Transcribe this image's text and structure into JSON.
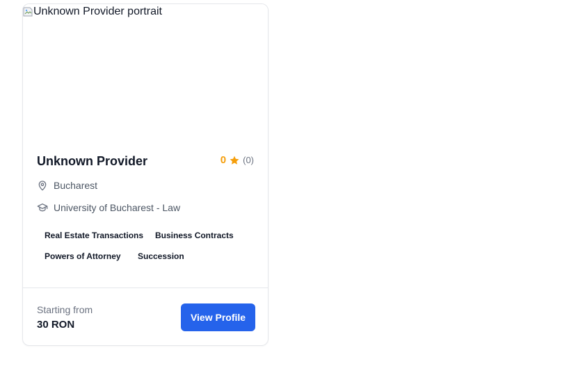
{
  "card": {
    "portrait_alt": "Unknown Provider portrait",
    "name": "Unknown Provider",
    "rating": {
      "value": "0",
      "count": "(0)",
      "star_icon": "star-icon",
      "star_color": "#f59e0b"
    },
    "location": {
      "icon": "map-pin-icon",
      "text": "Bucharest"
    },
    "education": {
      "icon": "graduation-cap-icon",
      "text": "University of Bucharest - Law"
    },
    "tags": [
      "Real Estate Transactions",
      "Business Contracts",
      "Powers of Attorney",
      "Succession"
    ],
    "price": {
      "label": "Starting from",
      "value": "30 RON"
    },
    "view_button_label": "View Profile"
  },
  "colors": {
    "accent": "#2563eb",
    "rating": "#f59e0b",
    "border": "#e5e7eb",
    "muted_text": "#6b7280"
  }
}
